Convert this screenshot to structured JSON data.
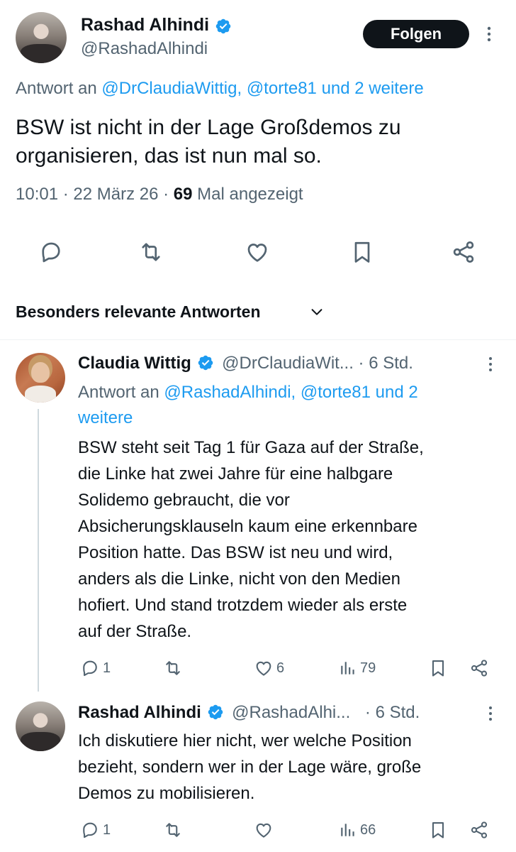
{
  "main_tweet": {
    "name": "Rashad Alhindi",
    "handle": "@RashadAlhindi",
    "follow_label": "Folgen",
    "reply_prefix": "Antwort an",
    "reply_to": "@DrClaudiaWittig, @torte81 und 2 weitere",
    "text_line1": "BSW ist nicht in der Lage Großdemos zu",
    "text_line2": "organisieren, das ist nun mal so.",
    "time": "10:01 · 22 März 26 · ",
    "views_count": "69",
    "views_label": " Mal angezeigt",
    "icons": [
      "reply-icon",
      "retweet-icon",
      "like-icon",
      "bookmark-icon",
      "share-icon"
    ]
  },
  "replies_header": {
    "label": "Besonders relevante Antworten"
  },
  "reply1": {
    "name": "Claudia Wittig",
    "handle": "@DrClaudiaWit...",
    "age": "· 6 Std.",
    "reply_prefix": "Antwort an",
    "reply_to_line1": "@RashadAlhindi, @torte81 und 2",
    "reply_to_line2": "weitere",
    "lines": [
      "BSW steht seit Tag 1 für Gaza auf der Straße,",
      "die Linke hat zwei Jahre für eine halbgare",
      "Solidemo gebraucht, die vor",
      "Absicherungsklauseln kaum eine erkennbare",
      "Position hatte. Das BSW ist neu und wird,",
      "anders als die Linke, nicht von den Medien",
      "hofiert. Und stand trotzdem wieder als erste",
      "auf der Straße."
    ],
    "replies": "1",
    "likes": "6",
    "views": "79"
  },
  "reply2": {
    "name": "Rashad Alhindi",
    "handle": "@RashadAlhi...",
    "age": "· 6 Std.",
    "lines": [
      "Ich diskutiere hier nicht, wer welche Position",
      "bezieht, sondern wer in der Lage wäre, große",
      "Demos zu mobilisieren."
    ],
    "replies": "1",
    "views": "66"
  },
  "colors": {
    "text": "#0f1419",
    "muted": "#536471",
    "link": "#1d9bf0",
    "verified": "#1d9bf0",
    "follow_bg": "#0f1419"
  }
}
